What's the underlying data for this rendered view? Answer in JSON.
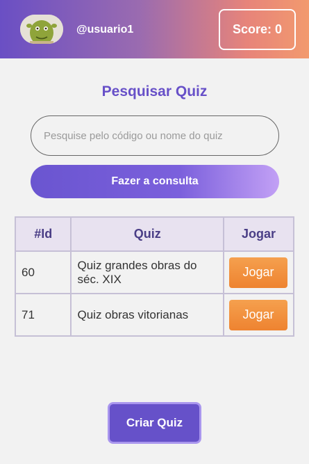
{
  "header": {
    "username": "@usuario1",
    "score": "Score: 0"
  },
  "search": {
    "title": "Pesquisar Quiz",
    "placeholder": "Pesquise pelo código ou nome do quiz",
    "button_label": "Fazer a consulta"
  },
  "table": {
    "headers": [
      "#Id",
      "Quiz",
      "Jogar"
    ],
    "rows": [
      {
        "id": "60",
        "quiz": "Quiz grandes obras do séc. XIX",
        "action": "Jogar"
      },
      {
        "id": "71",
        "quiz": "Quiz obras vitorianas",
        "action": "Jogar"
      }
    ]
  },
  "footer": {
    "create_label": "Criar Quiz"
  },
  "colors": {
    "accent": "#6651c9",
    "play_button": "#ee8330"
  }
}
